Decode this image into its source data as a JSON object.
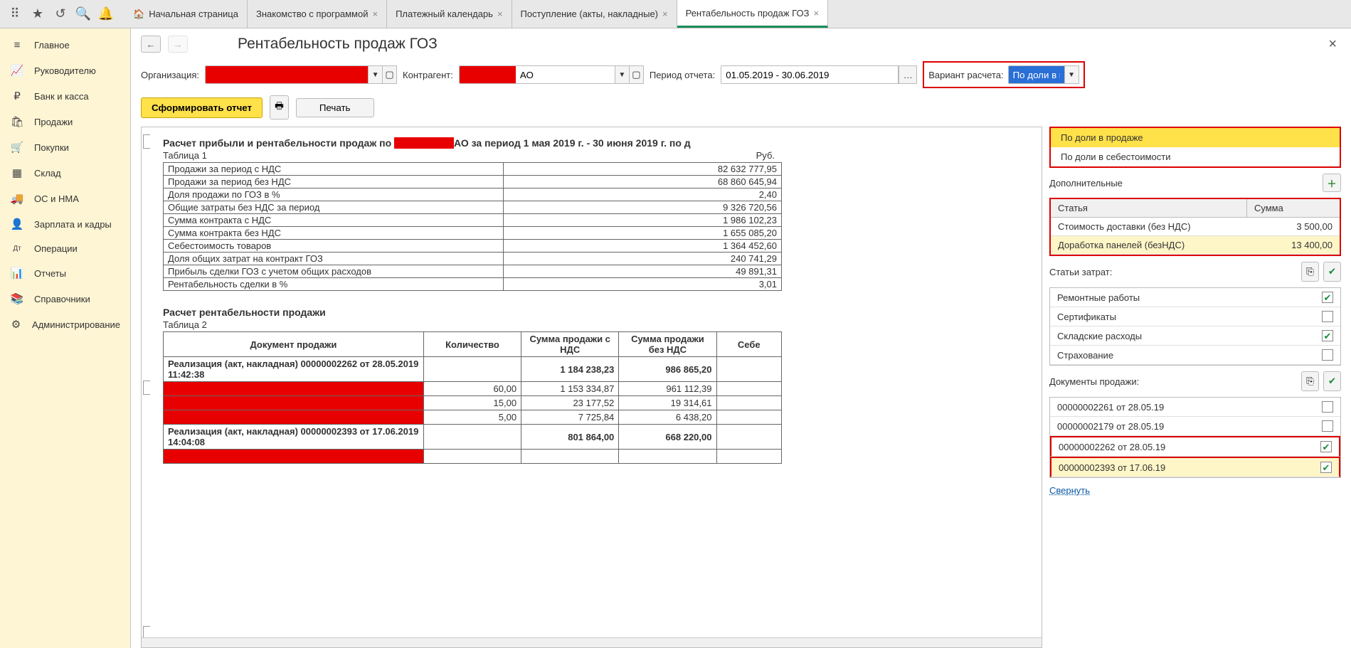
{
  "toolbar": {
    "tabs": [
      {
        "label": "Начальная страница",
        "home": true
      },
      {
        "label": "Знакомство с программой"
      },
      {
        "label": "Платежный календарь"
      },
      {
        "label": "Поступление (акты, накладные)"
      },
      {
        "label": "Рентабельность продаж ГОЗ",
        "active": true
      }
    ]
  },
  "sidebar": [
    {
      "icon": "≡",
      "label": "Главное"
    },
    {
      "icon": "📈",
      "label": "Руководителю"
    },
    {
      "icon": "₽",
      "label": "Банк и касса"
    },
    {
      "icon": "🛍",
      "label": "Продажи"
    },
    {
      "icon": "🛒",
      "label": "Покупки"
    },
    {
      "icon": "▦",
      "label": "Склад"
    },
    {
      "icon": "🚚",
      "label": "ОС и НМА"
    },
    {
      "icon": "👤",
      "label": "Зарплата и кадры"
    },
    {
      "icon": "Дт",
      "label": "Операции"
    },
    {
      "icon": "📊",
      "label": "Отчеты"
    },
    {
      "icon": "📚",
      "label": "Справочники"
    },
    {
      "icon": "⚙",
      "label": "Администрирование"
    }
  ],
  "page": {
    "title": "Рентабельность продаж ГОЗ",
    "close": "×"
  },
  "filters": {
    "org_label": "Организация:",
    "org_value": "",
    "contr_label": "Контрагент:",
    "contr_value": "АО",
    "period_label": "Период отчета:",
    "period_value": "01.05.2019 - 30.06.2019",
    "variant_label": "Вариант расчета:",
    "variant_value": "По доли в про"
  },
  "actions": {
    "form": "Сформировать отчет",
    "print": "Печать"
  },
  "report": {
    "title_prefix": "Расчет прибыли и рентабельности продаж по ",
    "title_suffix": "АО за период 1 мая 2019 г. - 30 июня 2019 г. по д",
    "table1_caption": "Таблица 1",
    "rub": "Руб.",
    "rows1": [
      {
        "name": "Продажи за период с НДС",
        "val": "82 632 777,95"
      },
      {
        "name": "Продажи за период без НДС",
        "val": "68 860 645,94"
      },
      {
        "name": "Доля продажи по ГОЗ в %",
        "val": "2,40"
      },
      {
        "name": "Общие затраты без НДС за период",
        "val": "9 326 720,56"
      },
      {
        "name": "Сумма контракта с НДС",
        "val": "1 986 102,23"
      },
      {
        "name": "Сумма контракта без НДС",
        "val": "1 655 085,20"
      },
      {
        "name": "Себестоимость товаров",
        "val": "1 364 452,60"
      },
      {
        "name": "Доля общих затрат на контракт ГОЗ",
        "val": "240 741,29"
      },
      {
        "name": "Прибыль сделки ГОЗ с учетом общих расходов",
        "val": "49 891,31"
      },
      {
        "name": "Рентабельность сделки в %",
        "val": "3,01"
      }
    ],
    "title2": "Расчет рентабельности продажи",
    "table2_caption": "Таблица 2",
    "cols2": [
      "Документ продажи",
      "Количество",
      "Сумма продажи с НДС",
      "Сумма продажи без НДС",
      "Себе"
    ],
    "rows2": [
      {
        "doc": "Реализация (акт, накладная) 00000002262 от 28.05.2019 11:42:38",
        "qty": "",
        "s1": "1 184 238,23",
        "s2": "986 865,20",
        "header": true
      },
      {
        "doc": "",
        "qty": "60,00",
        "s1": "1 153 334,87",
        "s2": "961 112,39",
        "red": true
      },
      {
        "doc": "",
        "qty": "15,00",
        "s1": "23 177,52",
        "s2": "19 314,61",
        "red": true
      },
      {
        "doc": "",
        "qty": "5,00",
        "s1": "7 725,84",
        "s2": "6 438,20",
        "red": true
      },
      {
        "doc": "Реализация (акт, накладная) 00000002393 от 17.06.2019 14:04:08",
        "qty": "",
        "s1": "801 864,00",
        "s2": "668 220,00",
        "header": true
      },
      {
        "doc": "",
        "qty": "",
        "s1": "",
        "s2": "",
        "red": true
      }
    ]
  },
  "right": {
    "dropdown": [
      {
        "label": "По доли в продаже",
        "sel": true
      },
      {
        "label": "По доли в себестоимости"
      }
    ],
    "additional_label": "Дополнительные",
    "grid1_headers": [
      "Статья",
      "Сумма"
    ],
    "grid1_rows": [
      {
        "name": "Стоимость доставки (без НДС)",
        "amt": "3 500,00"
      },
      {
        "name": "Доработка панелей (безНДС)",
        "amt": "13 400,00",
        "sel": true
      }
    ],
    "costs_label": "Статьи затрат:",
    "costs": [
      {
        "name": "Ремонтные работы",
        "checked": true
      },
      {
        "name": "Сертификаты",
        "checked": false
      },
      {
        "name": "Складские расходы",
        "checked": true
      },
      {
        "name": "Страхование",
        "checked": false
      }
    ],
    "docs_label": "Документы продажи:",
    "docs": [
      {
        "name": "00000002261 от 28.05.19",
        "checked": false
      },
      {
        "name": "00000002179 от 28.05.19",
        "checked": false
      },
      {
        "name": "00000002262 от 28.05.19",
        "checked": true,
        "hl": true
      },
      {
        "name": "00000002393 от 17.06.19",
        "checked": true,
        "hl": true,
        "sel": true
      }
    ],
    "collapse": "Свернуть"
  }
}
